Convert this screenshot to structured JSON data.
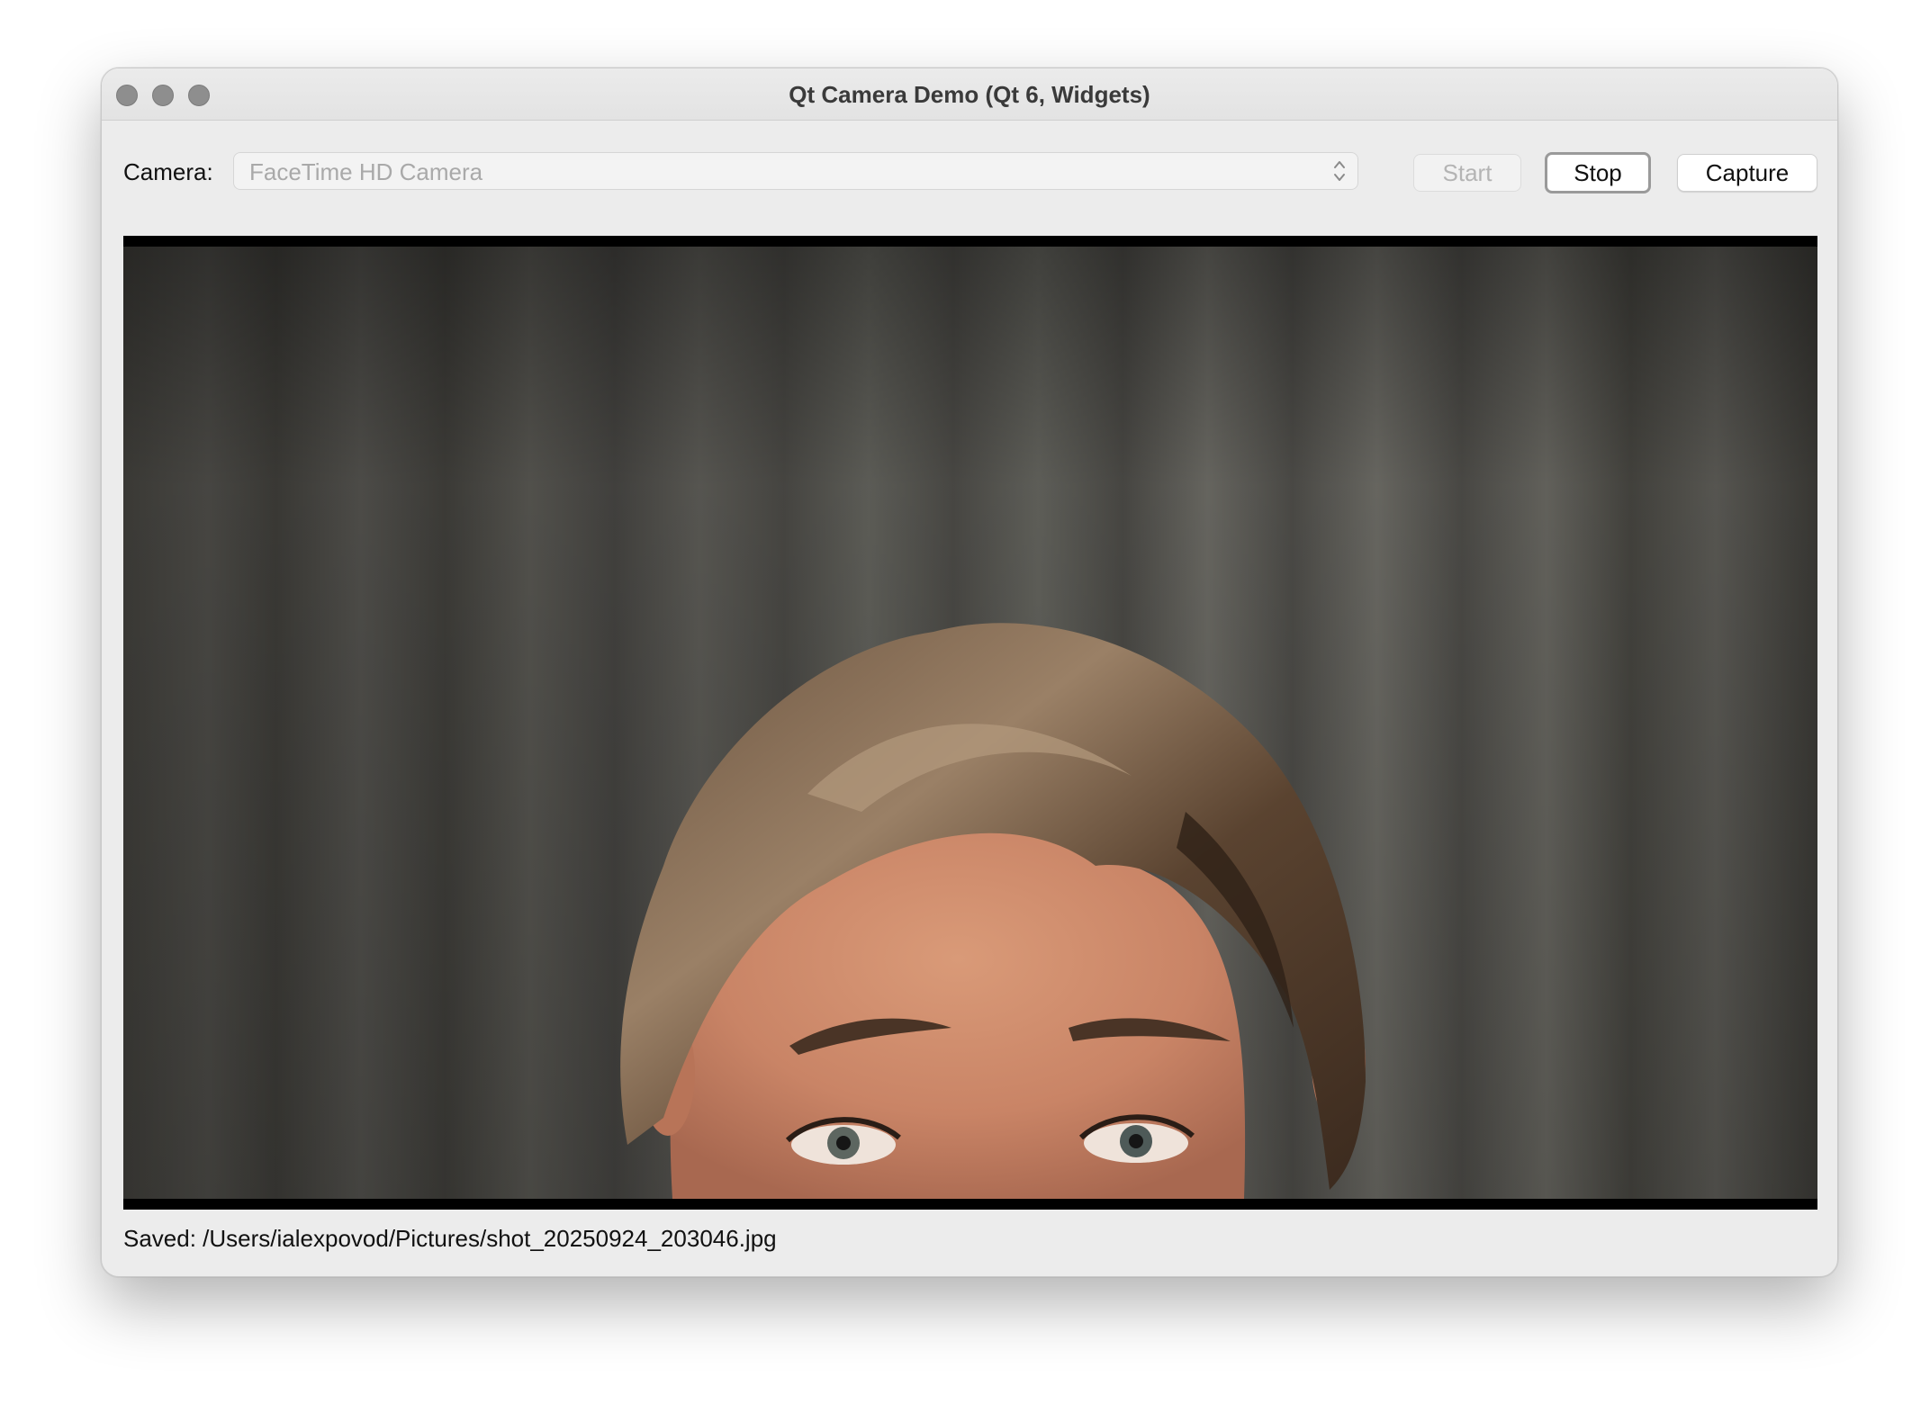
{
  "window": {
    "title": "Qt Camera Demo (Qt 6, Widgets)"
  },
  "toolbar": {
    "camera_label": "Camera:",
    "camera_selected": "FaceTime HD Camera",
    "start_label": "Start",
    "stop_label": "Stop",
    "capture_label": "Capture"
  },
  "video": {
    "content": "live-camera-preview"
  },
  "status": {
    "text": "Saved: /Users/ialexpovod/Pictures/shot_20250924_203046.jpg"
  }
}
